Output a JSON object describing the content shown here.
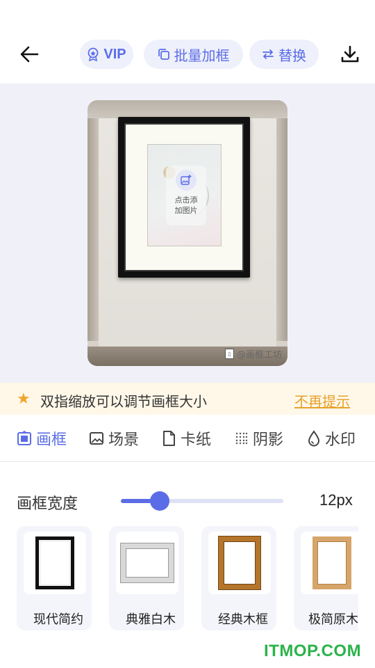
{
  "topbar": {
    "vip_label": "VIP",
    "batch_label": "批量加框",
    "replace_label": "替换"
  },
  "canvas": {
    "add_photo_label": "点击添加图片",
    "watermark_text": "@画框工坊"
  },
  "tip": {
    "text": "双指缩放可以调节画框大小",
    "dismiss_label": "不再提示"
  },
  "tabs": [
    {
      "label": "画框",
      "active": true
    },
    {
      "label": "场景",
      "active": false
    },
    {
      "label": "卡纸",
      "active": false
    },
    {
      "label": "阴影",
      "active": false
    },
    {
      "label": "水印",
      "active": false
    }
  ],
  "frame_width": {
    "label": "画框宽度",
    "value_text": "12px",
    "slider_fraction": 0.24
  },
  "frame_options": [
    {
      "label": "现代简约"
    },
    {
      "label": "典雅白木"
    },
    {
      "label": "经典木框"
    },
    {
      "label": "极简原木"
    }
  ],
  "site_mark": "ITMOP.COM",
  "colors": {
    "accent": "#5b6de6",
    "tip_bg": "#fff8e9",
    "tip_accent": "#e8a12c",
    "canvas_bg": "#f0f1f8"
  },
  "icons": [
    "back-arrow-icon",
    "vip-badge-icon",
    "batch-copy-icon",
    "swap-icon",
    "download-icon",
    "add-image-icon",
    "star-icon",
    "frame-icon",
    "scene-image-icon",
    "card-paper-icon",
    "shadow-dots-icon",
    "watermark-drop-icon"
  ]
}
